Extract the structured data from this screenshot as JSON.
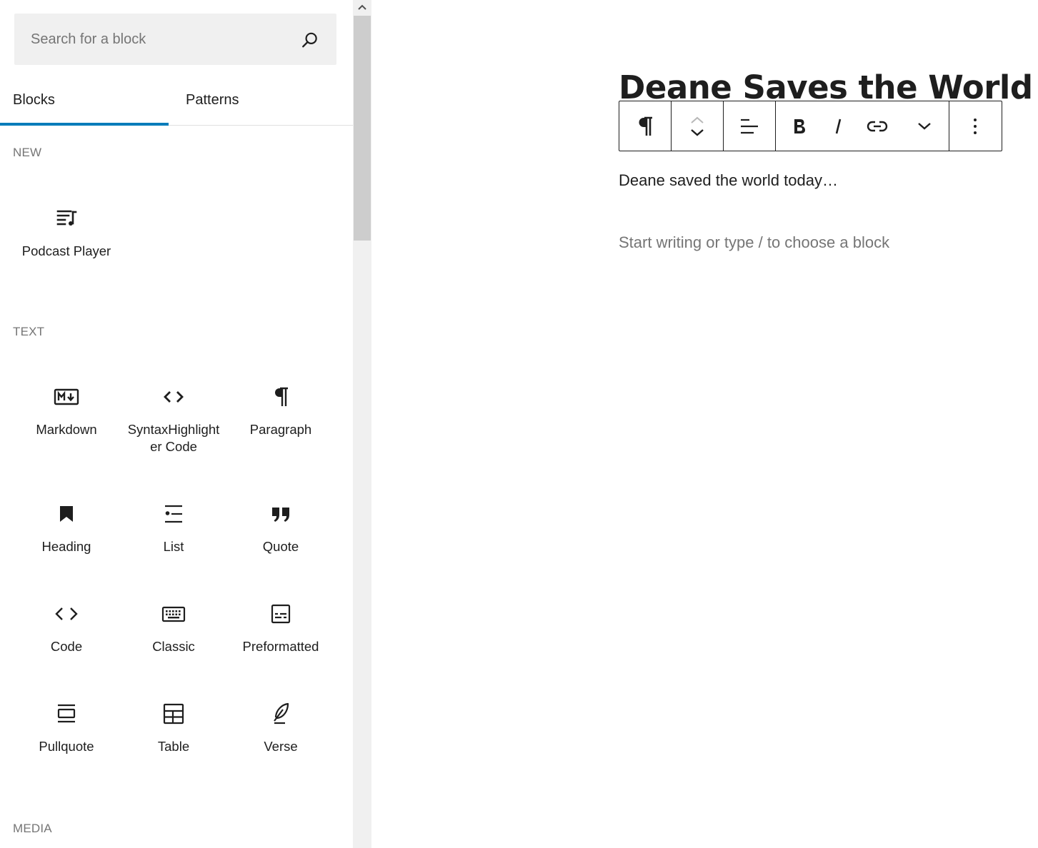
{
  "search": {
    "placeholder": "Search for a block",
    "icon": "search-icon"
  },
  "tabs": [
    {
      "label": "Blocks",
      "active": true
    },
    {
      "label": "Patterns",
      "active": false
    }
  ],
  "categories": [
    {
      "label": "NEW",
      "blocks": [
        {
          "label": "Podcast Player",
          "icon": "podcast-player-icon"
        }
      ]
    },
    {
      "label": "TEXT",
      "blocks": [
        {
          "label": "Markdown",
          "icon": "markdown-icon"
        },
        {
          "label": "SyntaxHighlighter Code",
          "icon": "syntax-code-icon"
        },
        {
          "label": "Paragraph",
          "icon": "paragraph-icon"
        },
        {
          "label": "Heading",
          "icon": "bookmark-icon"
        },
        {
          "label": "List",
          "icon": "list-icon"
        },
        {
          "label": "Quote",
          "icon": "quote-icon"
        },
        {
          "label": "Code",
          "icon": "code-icon"
        },
        {
          "label": "Classic",
          "icon": "keyboard-icon"
        },
        {
          "label": "Preformatted",
          "icon": "preformatted-icon"
        },
        {
          "label": "Pullquote",
          "icon": "pullquote-icon"
        },
        {
          "label": "Table",
          "icon": "table-icon"
        },
        {
          "label": "Verse",
          "icon": "feather-icon"
        }
      ]
    },
    {
      "label": "MEDIA",
      "blocks": []
    }
  ],
  "editor": {
    "title": "Deane Saves the World",
    "paragraph": "Deane saved the world today…",
    "placeholder": "Start writing or type / to choose a block"
  },
  "toolbar": {
    "buttons": [
      "paragraph-icon",
      "move-up-icon",
      "move-down-icon",
      "align-left-icon",
      "bold-icon",
      "italic-icon",
      "link-icon",
      "chevron-down-icon",
      "more-vertical-icon"
    ]
  },
  "colors": {
    "accent": "#007cba",
    "text": "#1e1e1e",
    "muted": "#757575",
    "search_bg": "#f0f0f0"
  }
}
